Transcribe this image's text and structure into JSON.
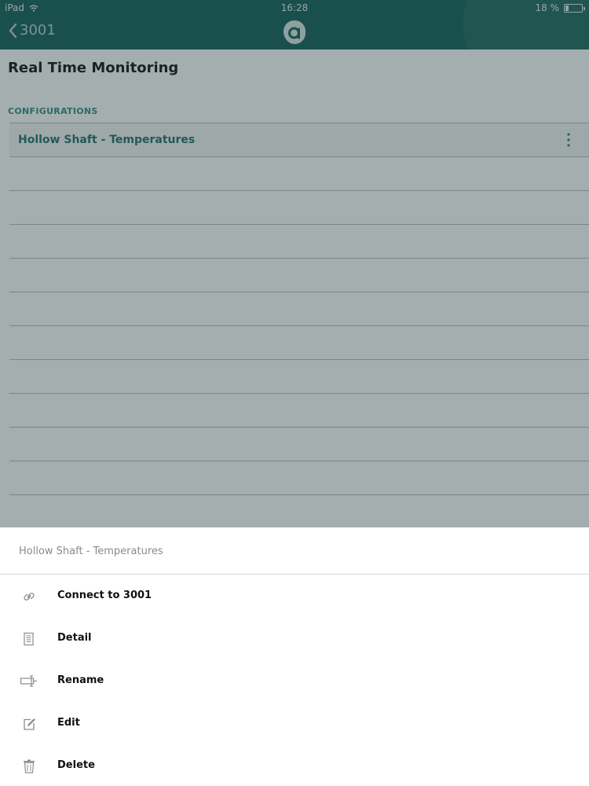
{
  "status_bar": {
    "device": "iPad",
    "time": "16:28",
    "battery": "18 %",
    "battery_level": 0.18
  },
  "nav": {
    "back_label": "3001",
    "bar_color": "#0f5e59"
  },
  "page": {
    "title": "Real Time Monitoring",
    "section_header": "CONFIGURATIONS",
    "configurations": [
      {
        "label": "Hollow Shaft - Temperatures"
      }
    ]
  },
  "action_sheet": {
    "title": "Hollow Shaft - Temperatures",
    "actions": [
      {
        "label": "Connect to 3001",
        "icon": "link-icon"
      },
      {
        "label": "Detail",
        "icon": "document-icon"
      },
      {
        "label": "Rename",
        "icon": "rename-icon"
      },
      {
        "label": "Edit",
        "icon": "edit-icon"
      },
      {
        "label": "Delete",
        "icon": "trash-icon"
      }
    ]
  },
  "colors": {
    "accent": "#2e8b80",
    "list_text": "#1e6f67"
  }
}
